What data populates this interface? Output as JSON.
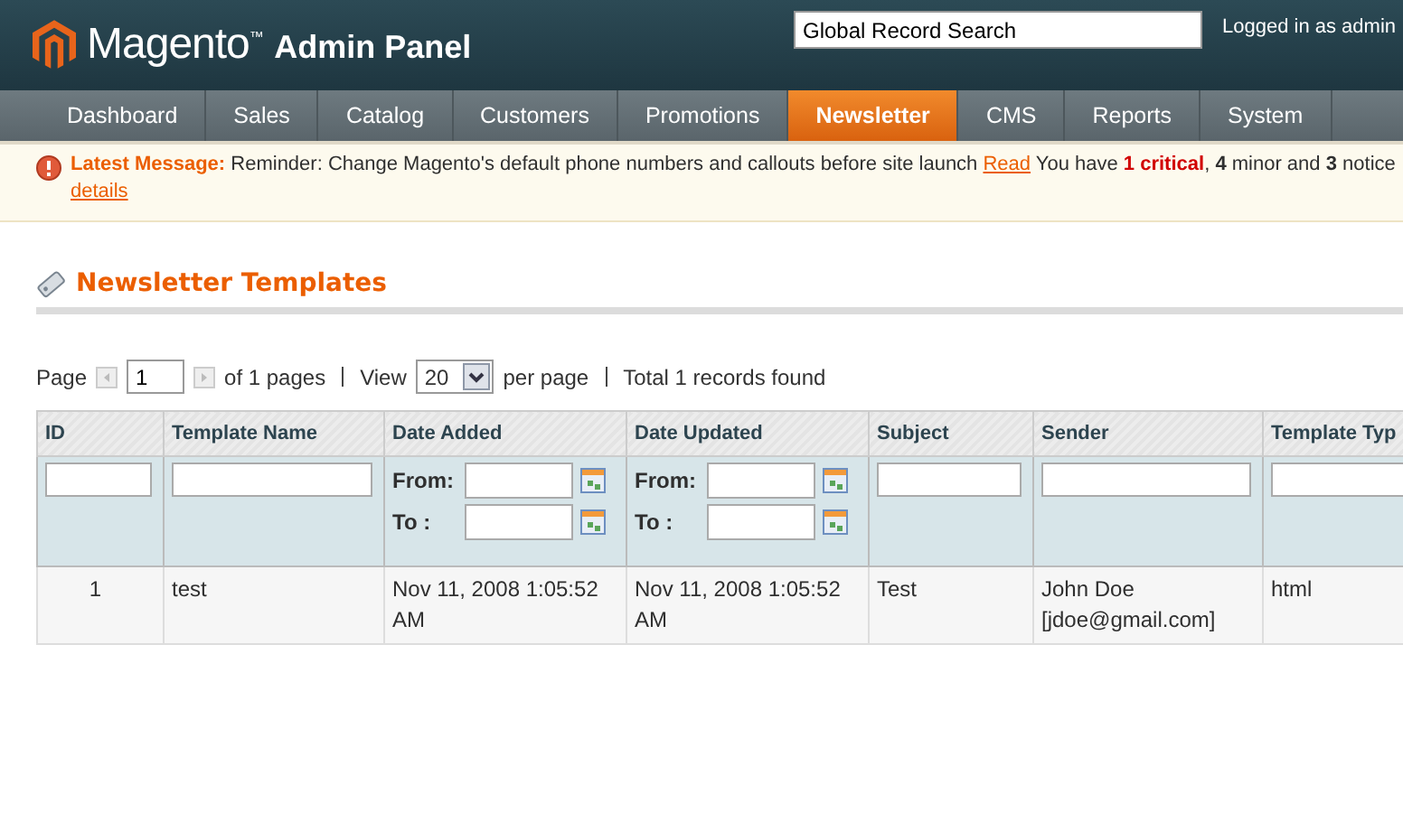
{
  "header": {
    "logo_word": "Magento",
    "logo_tm": "™",
    "logo_suffix": "Admin Panel",
    "search_value": "Global Record Search",
    "user_text": "Logged in as admin"
  },
  "nav": [
    {
      "label": "Dashboard",
      "selected": false
    },
    {
      "label": "Sales",
      "selected": false
    },
    {
      "label": "Catalog",
      "selected": false
    },
    {
      "label": "Customers",
      "selected": false
    },
    {
      "label": "Promotions",
      "selected": false
    },
    {
      "label": "Newsletter",
      "selected": true
    },
    {
      "label": "CMS",
      "selected": false
    },
    {
      "label": "Reports",
      "selected": false
    },
    {
      "label": "System",
      "selected": false
    }
  ],
  "message": {
    "label": "Latest Message:",
    "text": "Reminder: Change Magento's default phone numbers and callouts before site launch",
    "read_link": "Read",
    "summary": [
      {
        "kind": "plain",
        "text": "You have "
      },
      {
        "kind": "critical",
        "text": "1 critical"
      },
      {
        "kind": "plain",
        "text": ", "
      },
      {
        "kind": "bold",
        "text": "4"
      },
      {
        "kind": "plain",
        "text": " minor and "
      },
      {
        "kind": "bold",
        "text": "3"
      },
      {
        "kind": "plain",
        "text": " notice"
      }
    ],
    "details_link": "details"
  },
  "page_title": "Newsletter Templates",
  "pager": {
    "page_label": "Page",
    "page_value": "1",
    "of_pages": "of 1 pages",
    "view_label": "View",
    "per_page_value": "20",
    "per_page_label": "per page",
    "total": "Total 1 records found"
  },
  "table": {
    "columns": [
      {
        "label": "ID",
        "kind": "text"
      },
      {
        "label": "Template Name",
        "kind": "text"
      },
      {
        "label": "Date Added",
        "kind": "date",
        "from_label": "From:",
        "to_label": "To :"
      },
      {
        "label": "Date Updated",
        "kind": "date",
        "from_label": "From:",
        "to_label": "To :"
      },
      {
        "label": "Subject",
        "kind": "text"
      },
      {
        "label": "Sender",
        "kind": "text"
      },
      {
        "label": "Template Typ",
        "kind": "text"
      }
    ],
    "rows": [
      {
        "cells": [
          "1",
          "test",
          "Nov 11, 2008 1:05:52 AM",
          "Nov 11, 2008 1:05:52 AM",
          "Test",
          "John Doe [jdoe@gmail.com]",
          "html"
        ]
      }
    ]
  }
}
